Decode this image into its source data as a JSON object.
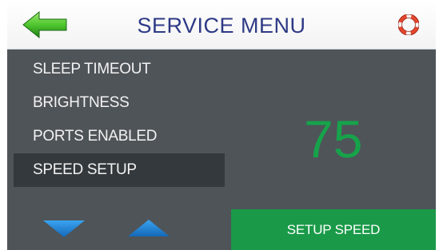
{
  "header": {
    "title": "SERVICE MENU",
    "back_icon": "green-left-arrow",
    "help_icon": "life-ring-icon"
  },
  "menu": {
    "items": [
      {
        "label": "SLEEP TIMEOUT"
      },
      {
        "label": "BRIGHTNESS"
      },
      {
        "label": "PORTS ENABLED"
      },
      {
        "label": "SPEED SETUP",
        "selected": true
      }
    ]
  },
  "display": {
    "value": "75"
  },
  "controls": {
    "down_icon": "down-triangle-icon",
    "up_icon": "up-triangle-icon",
    "action_label": "SETUP SPEED"
  },
  "colors": {
    "background": "#4f5459",
    "selected": "#34393d",
    "accent_green": "#16a34a",
    "button_green": "#1a9a48",
    "arrow_blue": "#2a8fdc",
    "title": "#2e3a86"
  }
}
